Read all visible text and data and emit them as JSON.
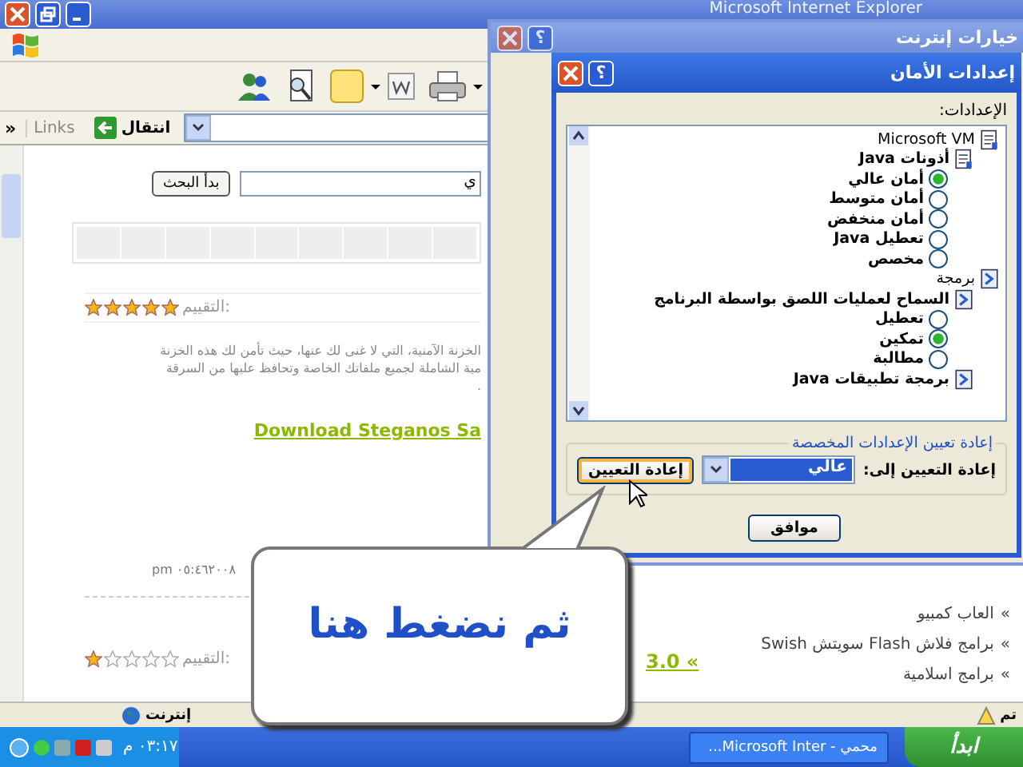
{
  "browser": {
    "title": "Microsoft Internet Explorer",
    "address": {
      "go_label": "انتقال",
      "links_label": "Links",
      "more": "»"
    },
    "search": {
      "button": "بدأ البحث",
      "value": "ي"
    },
    "status": {
      "text": "تم",
      "zone": "إنترنت"
    }
  },
  "page": {
    "rating": {
      "label": "التقييم:",
      "stars": 5
    },
    "description": [
      "الخزنة الآمنية، التي لا غنى لك عنها، حيث تأمن لك هذه الخزنة",
      "مية الشاملة لجميع ملفاتك الخاصة وتحافظ عليها من السرقة",
      "."
    ],
    "download_link": "Download Steganos Sa",
    "date": "pm ٠٥:٤٦٢٠٠٨",
    "rating_2": {
      "label": "التقييم:",
      "stars": 1
    },
    "version_link": "3.0 «",
    "side_links": [
      {
        "marker": "»",
        "text": "العاب كمبيو"
      },
      {
        "marker": "»",
        "text": "برامج فلاش Flash سويتش Swish"
      },
      {
        "marker": "»",
        "text": "برامج اسلامية"
      }
    ]
  },
  "options_dialog": {
    "title": "خيارات إنترنت",
    "help": "؟"
  },
  "security_dialog": {
    "title": "إعدادات الأمان",
    "help": "؟",
    "settings_label": "الإعدادات:",
    "tree": [
      {
        "kind": "doc",
        "label": "Microsoft VM",
        "children": [
          {
            "kind": "doc",
            "label": "أذونات Java",
            "children": [
              {
                "kind": "radio",
                "label": "أمان عالي",
                "selected": true
              },
              {
                "kind": "radio",
                "label": "أمان متوسط",
                "selected": false
              },
              {
                "kind": "radio",
                "label": "أمان منخفض",
                "selected": false
              },
              {
                "kind": "radio",
                "label": "تعطيل Java",
                "selected": false
              },
              {
                "kind": "radio",
                "label": "مخصص",
                "selected": false
              }
            ]
          }
        ]
      },
      {
        "kind": "script",
        "label": "برمجة",
        "children": [
          {
            "kind": "script",
            "label": "السماح لعمليات اللصق بواسطة البرنامج",
            "children": [
              {
                "kind": "radio",
                "label": "تعطيل",
                "selected": false
              },
              {
                "kind": "radio",
                "label": "تمكين",
                "selected": true
              },
              {
                "kind": "radio",
                "label": "مطالبة",
                "selected": false
              }
            ]
          },
          {
            "kind": "script",
            "label": "برمجة تطبيقات Java"
          }
        ]
      }
    ],
    "reset_group": "إعادة تعيين الإعدادات المخصصة",
    "reset_label": "إعادة التعيين إلى:",
    "reset_value": "عالي",
    "reset_button": "إعادة التعيين",
    "ok_button": "موافق"
  },
  "callout": {
    "text": "ثم نضغط هنا"
  },
  "taskbar": {
    "start": "ابدأ",
    "task": "...Microsoft Inter - محمي",
    "clock": "٠٣:١٧ م"
  }
}
